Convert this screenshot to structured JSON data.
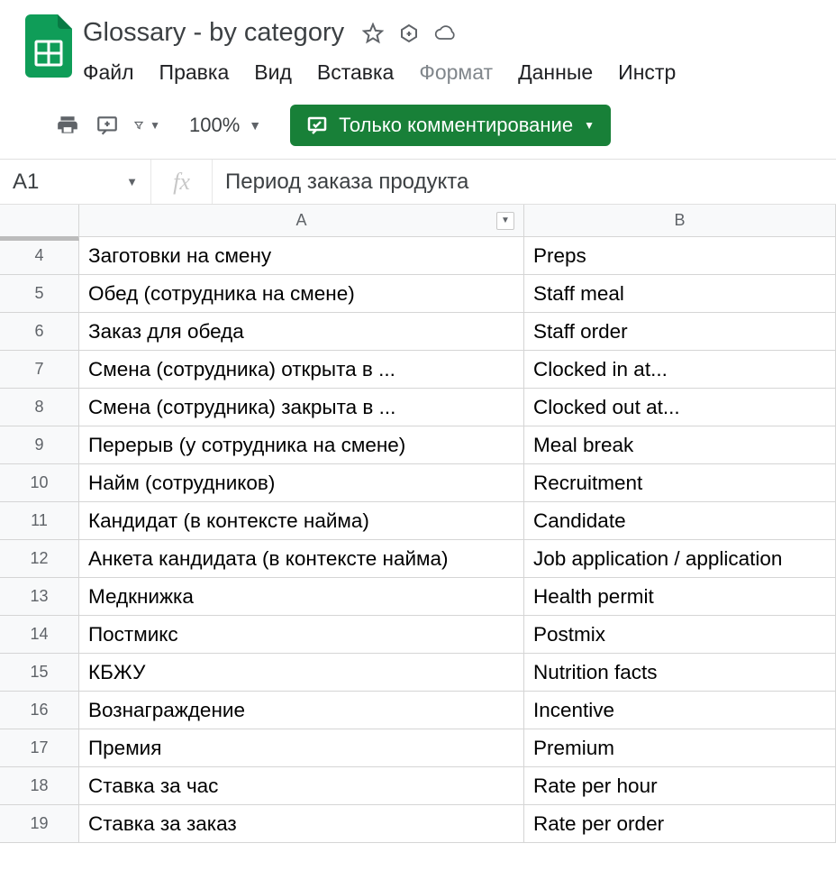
{
  "doc": {
    "title": "Glossary - by category"
  },
  "menu": {
    "file": "Файл",
    "edit": "Правка",
    "view": "Вид",
    "insert": "Вставка",
    "format": "Формат",
    "data": "Данные",
    "tools": "Инстр"
  },
  "toolbar": {
    "zoom": "100%",
    "comment_only": "Только комментирование"
  },
  "formula_bar": {
    "name_box": "A1",
    "fx": "fx",
    "value": "Период заказа продукта"
  },
  "columns": {
    "a": "A",
    "b": "B"
  },
  "rows": [
    {
      "n": "4",
      "a": "Заготовки на смену",
      "b": "Preps"
    },
    {
      "n": "5",
      "a": "Обед (сотрудника на смене)",
      "b": "Staff meal"
    },
    {
      "n": "6",
      "a": "Заказ для обеда",
      "b": "Staff order"
    },
    {
      "n": "7",
      "a": "Смена (сотрудника) открыта в ...",
      "b": "Clocked in at..."
    },
    {
      "n": "8",
      "a": "Смена (сотрудника) закрыта в ...",
      "b": "Clocked out at..."
    },
    {
      "n": "9",
      "a": "Перерыв (у сотрудника на смене)",
      "b": "Meal break"
    },
    {
      "n": "10",
      "a": "Найм (сотрудников)",
      "b": "Recruitment"
    },
    {
      "n": "11",
      "a": "Кандидат (в контексте найма)",
      "b": "Candidate"
    },
    {
      "n": "12",
      "a": "Анкета кандидата (в контексте найма)",
      "b": "Job application / application"
    },
    {
      "n": "13",
      "a": "Медкнижка",
      "b": "Health permit"
    },
    {
      "n": "14",
      "a": "Постмикс",
      "b": "Postmix"
    },
    {
      "n": "15",
      "a": "КБЖУ",
      "b": "Nutrition facts"
    },
    {
      "n": "16",
      "a": "Вознаграждение",
      "b": "Incentive"
    },
    {
      "n": "17",
      "a": "Премия",
      "b": "Premium"
    },
    {
      "n": "18",
      "a": "Ставка за час",
      "b": "Rate per hour"
    },
    {
      "n": "19",
      "a": "Ставка за заказ",
      "b": "Rate per order"
    }
  ]
}
